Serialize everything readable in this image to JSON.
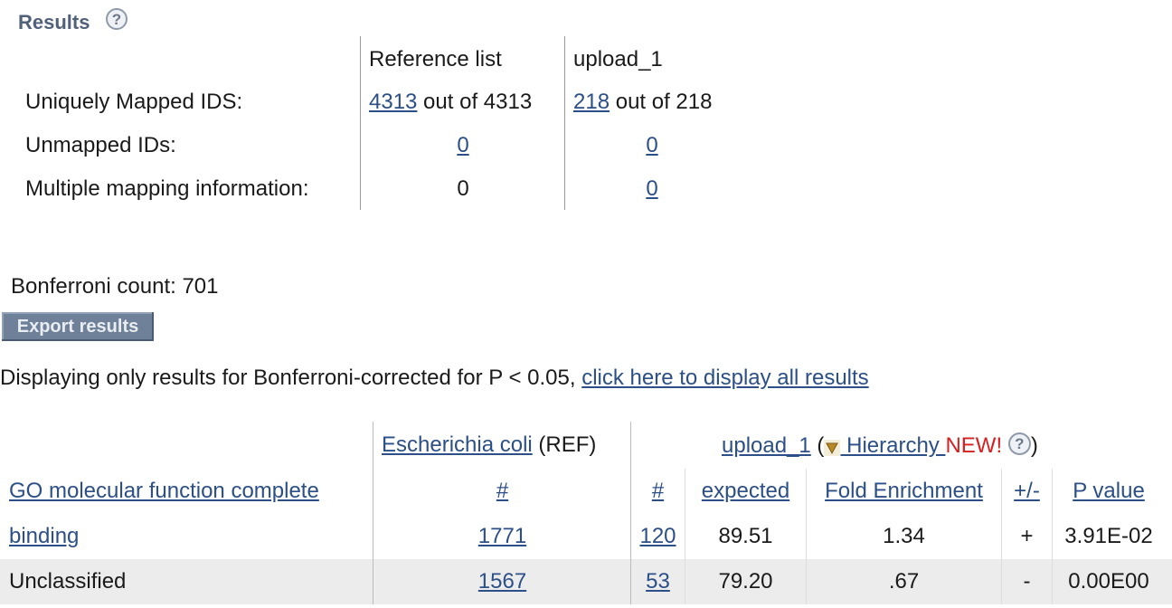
{
  "results": {
    "heading": "Results",
    "help_icon": "help-icon"
  },
  "mapping": {
    "columns": [
      "Reference list",
      "upload_1"
    ],
    "rows": [
      {
        "label": "Uniquely Mapped IDS:",
        "ref_link": "4313",
        "ref_text": " out of 4313",
        "up_link": "218",
        "up_text": " out of 218"
      },
      {
        "label": "Unmapped IDs:",
        "ref_link": "0",
        "up_link": "0"
      },
      {
        "label": "Multiple mapping information:",
        "ref_value": "0",
        "up_link": "0"
      }
    ]
  },
  "bonferroni_text": "Bonferroni count: 701",
  "export_label": "Export results",
  "display": {
    "text": "Displaying only results for Bonferroni-corrected for P < 0.05, ",
    "link": "click here to display all results"
  },
  "table": {
    "ref_species": "Escherichia coli",
    "ref_tag": " (REF)",
    "upload_link": "upload_1",
    "hierarchy_prefix": " (",
    "hierarchy_link": " Hierarchy ",
    "new_badge": " NEW!",
    "hierarchy_suffix": ")",
    "headers": {
      "category": "GO molecular function complete",
      "ref_count": "#",
      "up_count": "#",
      "expected": "expected",
      "fold": "Fold Enrichment",
      "sign": "+/-",
      "pvalue": "P value"
    },
    "rows": [
      {
        "category": "binding",
        "category_link": true,
        "ref_count": "1771",
        "up_count": "120",
        "expected": "89.51",
        "fold": "1.34",
        "sign": "+",
        "pvalue": "3.91E-02"
      },
      {
        "category": "Unclassified",
        "category_link": false,
        "ref_count": "1567",
        "up_count": "53",
        "expected": "79.20",
        "fold": ".67",
        "sign": "-",
        "pvalue": "0.00E00"
      }
    ]
  },
  "colors": {
    "link": "#2b4f86",
    "new_badge": "#d6201f",
    "export_button": "#6e8199",
    "heading": "#52617a"
  }
}
